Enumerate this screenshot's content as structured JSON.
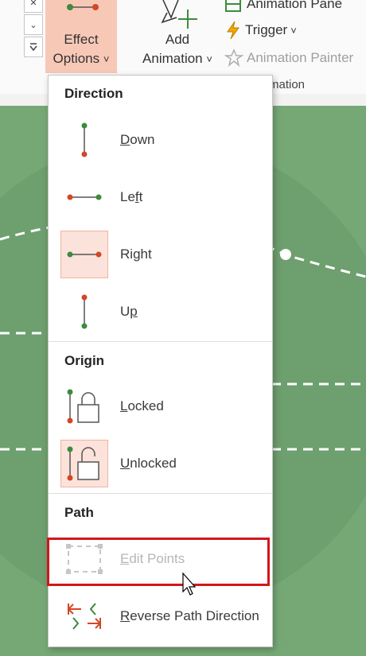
{
  "ribbon": {
    "effect_options": {
      "line1": "Effect",
      "line2": "Options",
      "chevron": "˅"
    },
    "add_animation": {
      "line1": "Add",
      "line2": "Animation",
      "chevron": "˅"
    },
    "animation_pane": "Animation Pane",
    "trigger": "Trigger",
    "trigger_chevron": "˅",
    "animation_painter": "Animation Painter",
    "group_label": "mation"
  },
  "menu": {
    "direction_header": "Direction",
    "direction_items": [
      {
        "accel": "D",
        "rest": "own",
        "icon": "vertical-line-down-icon"
      },
      {
        "pre": "Le",
        "accel": "f",
        "rest": "t",
        "icon": "horizontal-line-left-icon"
      },
      {
        "pre": "Ri",
        "accel": "g",
        "rest": "ht",
        "icon": "horizontal-line-right-icon",
        "selected": true
      },
      {
        "pre": "U",
        "accel": "p",
        "rest": "",
        "icon": "vertical-line-up-icon"
      }
    ],
    "origin_header": "Origin",
    "origin_items": [
      {
        "accel": "L",
        "rest": "ocked",
        "icon": "lock-closed-icon"
      },
      {
        "accel": "U",
        "rest": "nlocked",
        "icon": "lock-open-icon",
        "selected": true
      }
    ],
    "path_header": "Path",
    "path_items": [
      {
        "accel": "E",
        "rest": "dit Points",
        "icon": "edit-points-icon",
        "disabled": true
      },
      {
        "accel": "R",
        "rest": "everse Path Direction",
        "icon": "reverse-path-icon"
      }
    ]
  },
  "colors": {
    "green_dot": "#3d8b3d",
    "red_dot": "#d24726",
    "slide_bg": "#76a876",
    "effect_bg": "#f8c8b7",
    "highlight": "#d1171b"
  }
}
